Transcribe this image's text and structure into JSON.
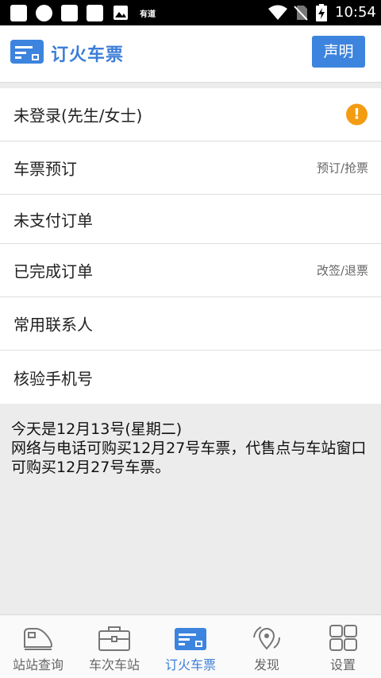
{
  "status_bar": {
    "app_label": "有道",
    "time": "10:54"
  },
  "header": {
    "title": "订火车票",
    "declare_button": "声明",
    "accent_color": "#3d84de"
  },
  "menu": {
    "items": [
      {
        "label": "未登录(先生/女士)",
        "hint": "",
        "icon": "warning-icon"
      },
      {
        "label": "车票预订",
        "hint": "预订/抢票"
      },
      {
        "label": "未支付订单",
        "hint": ""
      },
      {
        "label": "已完成订单",
        "hint": "改签/退票"
      },
      {
        "label": "常用联系人",
        "hint": ""
      },
      {
        "label": "核验手机号",
        "hint": ""
      }
    ]
  },
  "info": {
    "line1": "今天是12月13号(星期二)",
    "line2": "网络与电话可购买12月27号车票，代售点与车站窗口可购买12月27号车票。"
  },
  "bottom_nav": {
    "items": [
      {
        "label": "站站查询",
        "icon": "train-icon",
        "active": false
      },
      {
        "label": "车次车站",
        "icon": "briefcase-icon",
        "active": false
      },
      {
        "label": "订火车票",
        "icon": "ticket-icon",
        "active": true
      },
      {
        "label": "发现",
        "icon": "compass-location-icon",
        "active": false
      },
      {
        "label": "设置",
        "icon": "grid-settings-icon",
        "active": false
      }
    ]
  }
}
